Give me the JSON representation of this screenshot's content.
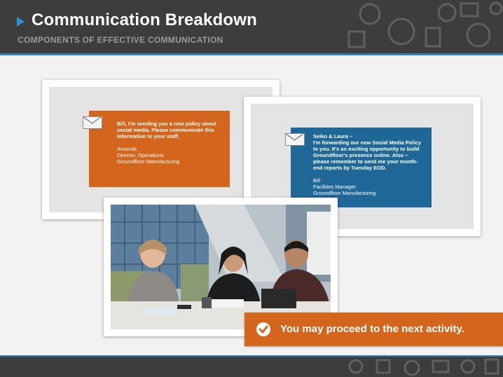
{
  "header": {
    "title": "Communication Breakdown",
    "subtitle": "COMPONENTS OF EFFECTIVE COMMUNICATION"
  },
  "cards": {
    "orange_message": {
      "body": "Bill, I'm sending you a new policy about social media. Please communicate this information to your staff.",
      "sig_name": "Amanda",
      "sig_title": "Director, Operations",
      "sig_company": "Groundfloor Manufacturing"
    },
    "blue_message": {
      "greeting": "Seiko & Laura –",
      "body": "I'm forwarding our new Social Media Policy to you. It's an exciting opportunity to build Groundfloor's presence online. Also – please remember to send me your month-end reports by Tuesday EOD.",
      "sig_name": "Bill",
      "sig_title": "Facilities Manager",
      "sig_company": "Groundfloor Manufacturing"
    }
  },
  "toast": {
    "text": "You may proceed to the next activity."
  },
  "colors": {
    "accent_orange": "#d4651d",
    "accent_blue": "#1f6796",
    "header_bg": "#3d3d3d",
    "rule_blue": "#2a7fb9"
  }
}
